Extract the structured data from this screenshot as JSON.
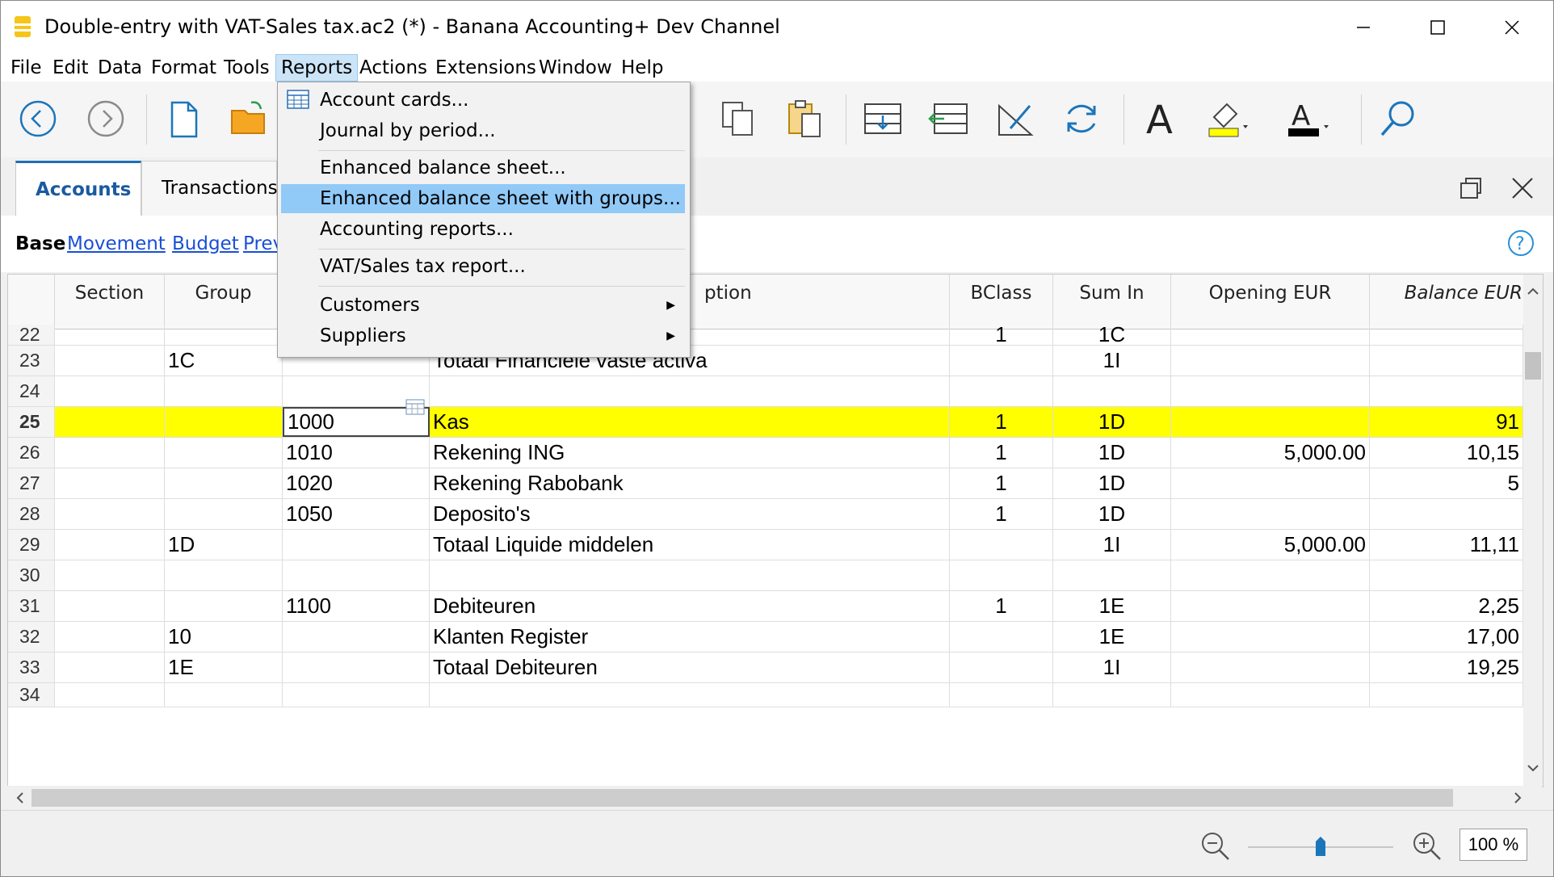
{
  "window": {
    "title": "Double-entry with VAT-Sales tax.ac2 (*) - Banana Accounting+ Dev Channel"
  },
  "menubar": [
    "File",
    "Edit",
    "Data",
    "Format",
    "Tools",
    "Reports",
    "Actions",
    "Extensions",
    "Window",
    "Help"
  ],
  "reports_menu": {
    "items": [
      {
        "label": "Account cards..."
      },
      {
        "label": "Journal by period..."
      },
      {
        "label": "Enhanced balance sheet..."
      },
      {
        "label": "Enhanced balance sheet with groups..."
      },
      {
        "label": "Accounting reports..."
      },
      {
        "label": "VAT/Sales tax report..."
      },
      {
        "label": "Customers"
      },
      {
        "label": "Suppliers"
      }
    ]
  },
  "tabs": [
    "Accounts",
    "Transactions"
  ],
  "views": [
    "Base",
    "Movement",
    "Budget",
    "Prev"
  ],
  "columns": {
    "section": "Section",
    "group": "Group",
    "description": "ption",
    "bclass": "BClass",
    "sumin": "Sum In",
    "opening": "Opening EUR",
    "balance": "Balance EUR"
  },
  "rows": [
    {
      "n": "22",
      "section": "",
      "group": "",
      "account": "",
      "desc": "",
      "bclass": "1",
      "sumin": "1C",
      "opening": "",
      "balance": ""
    },
    {
      "n": "23",
      "section": "",
      "group": "1C",
      "account": "",
      "desc": "Totaal Financiële vaste activa",
      "bclass": "",
      "sumin": "1I",
      "opening": "",
      "balance": ""
    },
    {
      "n": "24",
      "section": "",
      "group": "",
      "account": "",
      "desc": "",
      "bclass": "",
      "sumin": "",
      "opening": "",
      "balance": ""
    },
    {
      "n": "25",
      "section": "",
      "group": "",
      "account": "1000",
      "desc": "Kas",
      "bclass": "1",
      "sumin": "1D",
      "opening": "",
      "balance": "91"
    },
    {
      "n": "26",
      "section": "",
      "group": "",
      "account": "1010",
      "desc": "Rekening ING",
      "bclass": "1",
      "sumin": "1D",
      "opening": "5,000.00",
      "balance": "10,15"
    },
    {
      "n": "27",
      "section": "",
      "group": "",
      "account": "1020",
      "desc": "Rekening Rabobank",
      "bclass": "1",
      "sumin": "1D",
      "opening": "",
      "balance": "5"
    },
    {
      "n": "28",
      "section": "",
      "group": "",
      "account": "1050",
      "desc": "Deposito's",
      "bclass": "1",
      "sumin": "1D",
      "opening": "",
      "balance": ""
    },
    {
      "n": "29",
      "section": "",
      "group": "1D",
      "account": "",
      "desc": "Totaal Liquide middelen",
      "bclass": "",
      "sumin": "1I",
      "opening": "5,000.00",
      "balance": "11,11"
    },
    {
      "n": "30",
      "section": "",
      "group": "",
      "account": "",
      "desc": "",
      "bclass": "",
      "sumin": "",
      "opening": "",
      "balance": ""
    },
    {
      "n": "31",
      "section": "",
      "group": "",
      "account": "1100",
      "desc": "Debiteuren",
      "bclass": "1",
      "sumin": "1E",
      "opening": "",
      "balance": "2,25"
    },
    {
      "n": "32",
      "section": "",
      "group": "10",
      "account": "",
      "desc": "Klanten Register",
      "bclass": "",
      "sumin": "1E",
      "opening": "",
      "balance": "17,00"
    },
    {
      "n": "33",
      "section": "",
      "group": "1E",
      "account": "",
      "desc": "Totaal Debiteuren",
      "bclass": "",
      "sumin": "1I",
      "opening": "",
      "balance": "19,25"
    },
    {
      "n": "34",
      "section": "",
      "group": "",
      "account": "",
      "desc": "",
      "bclass": "",
      "sumin": "",
      "opening": "",
      "balance": ""
    }
  ],
  "status": {
    "zoom": "100 %"
  },
  "colors": {
    "highlight": "#ffff00",
    "accent": "#1f6fb5",
    "menu_hover": "#91c9f7"
  }
}
